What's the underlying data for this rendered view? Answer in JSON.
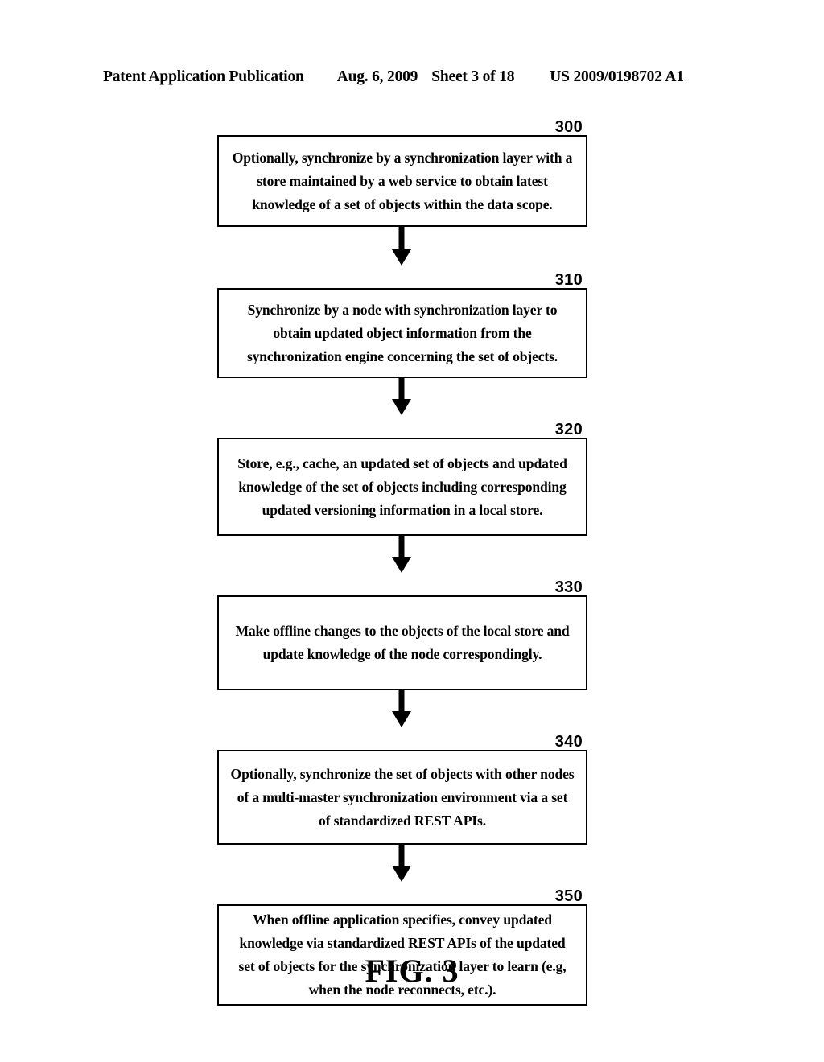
{
  "header": {
    "publication": "Patent Application Publication",
    "date": "Aug. 6, 2009",
    "sheet": "Sheet 3 of 18",
    "patent_number": "US 2009/0198702 A1"
  },
  "figure": {
    "caption": "FIG. 3",
    "type": "flowchart",
    "steps": [
      {
        "ref": "300",
        "text": "Optionally, synchronize by a synchronization layer with a store maintained by a web service to obtain latest knowledge of a set of objects within the data scope."
      },
      {
        "ref": "310",
        "text": "Synchronize by a node with synchronization layer to obtain updated object information from the synchronization engine concerning the set of objects."
      },
      {
        "ref": "320",
        "text": "Store, e.g., cache, an updated set of objects and updated knowledge of the set of objects including corresponding updated versioning information in a local store."
      },
      {
        "ref": "330",
        "text": "Make offline changes to the objects of the local store and update knowledge of the node correspondingly."
      },
      {
        "ref": "340",
        "text": "Optionally, synchronize the set of objects with other nodes of a multi-master synchronization environment via a set of standardized REST APIs."
      },
      {
        "ref": "350",
        "text": "When offline application specifies, convey updated knowledge via standardized REST APIs of the updated set of objects for the synchronization layer to learn (e.g, when the node reconnects, etc.)."
      }
    ]
  },
  "colors": {
    "ink": "#000000",
    "paper": "#ffffff"
  }
}
